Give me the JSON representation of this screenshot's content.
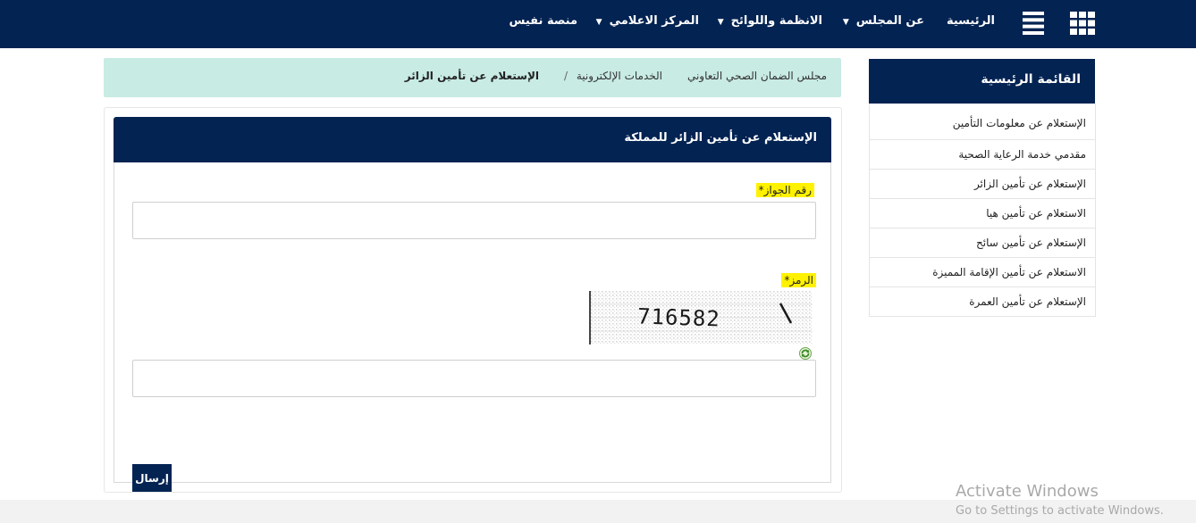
{
  "nav": {
    "home": "الرئيسية",
    "about": "عن المجلس",
    "regulations": "الانظمة واللوائح",
    "media": "المركز الاعلامي",
    "nafis": "منصة نفيس",
    "caret": "▼"
  },
  "breadcrumb": {
    "council": "مجلس الضمان الصحي التعاوني",
    "eservices": "الخدمات الإلكترونية",
    "separator": "/",
    "current": "الإستعلام عن تأمين الزائر"
  },
  "form": {
    "title": "الإستعلام عن تأمين الزائر للمملكة",
    "passport_label": "رقم الجواز*",
    "passport_value": "",
    "code_label": "الرمز*",
    "code_value": "",
    "captcha_text": "716582",
    "submit_label": "إرسال"
  },
  "sidebar": {
    "title": "القائمة الرئيسية",
    "items": [
      "الإستعلام عن معلومات التأمين",
      "مقدمي خدمة الرعاية الصحية",
      "الإستعلام عن تأمين الزائر",
      "الاستعلام عن تأمين هيا",
      "الإستعلام عن تأمين سائح",
      "الاستعلام عن تأمين الإقامة المميزة",
      "الإستعلام عن تأمين العمرة"
    ]
  },
  "watermark": {
    "line1": "Activate Windows",
    "line2": "Go to Settings to activate Windows."
  },
  "colors": {
    "navy": "#032352",
    "breadcrumb_bg": "#c8ebe4",
    "label_highlight": "#fff200"
  }
}
